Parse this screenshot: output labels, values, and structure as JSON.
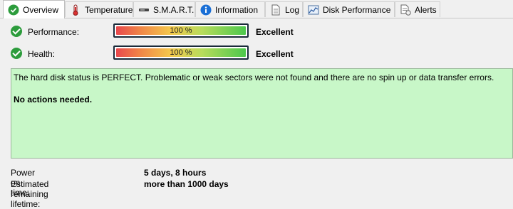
{
  "tabs": [
    {
      "label": "Overview",
      "icon": "green-check-icon",
      "active": true
    },
    {
      "label": "Temperature",
      "icon": "thermometer-icon",
      "active": false
    },
    {
      "label": "S.M.A.R.T.",
      "icon": "disk-drive-icon",
      "active": false
    },
    {
      "label": "Information",
      "icon": "info-icon",
      "active": false
    },
    {
      "label": "Log",
      "icon": "document-icon",
      "active": false
    },
    {
      "label": "Disk Performance",
      "icon": "chart-icon",
      "active": false
    },
    {
      "label": "Alerts",
      "icon": "alert-document-icon",
      "active": false
    }
  ],
  "performance": {
    "label": "Performance:",
    "percent": 100,
    "percent_text": "100 %",
    "rating": "Excellent"
  },
  "health": {
    "label": "Health:",
    "percent": 100,
    "percent_text": "100 %",
    "rating": "Excellent"
  },
  "status_panel": {
    "message": "The hard disk status is PERFECT. Problematic or weak sectors were not found and there are no spin up or data transfer errors.",
    "actions": "No actions needed.",
    "background_color": "#c8f7c8"
  },
  "info": {
    "power_on_label": "Power on time:",
    "power_on_value": "5 days, 8 hours",
    "lifetime_label": "Estimated remaining lifetime:",
    "lifetime_value": "more than 1000 days"
  }
}
